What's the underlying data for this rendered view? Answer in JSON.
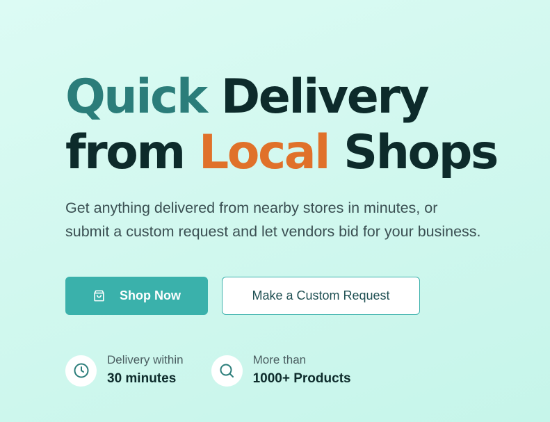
{
  "hero": {
    "headline": {
      "line1_word1": "Quick",
      "line1_word2": "Delivery",
      "line2_word1": "from",
      "line2_word2": "Local",
      "line2_word3": "Shops"
    },
    "subtitle_line1": "Get anything delivered from nearby stores in minutes, or",
    "subtitle_line2": "submit a custom request and let vendors bid for your business."
  },
  "buttons": {
    "shop_now": {
      "label": "Shop Now",
      "icon": "shopping-bag-icon"
    },
    "custom_request": {
      "label": "Make a Custom Request"
    }
  },
  "features": [
    {
      "icon": "clock-icon",
      "label": "Delivery within",
      "value": "30 minutes"
    },
    {
      "icon": "search-icon",
      "label": "More than",
      "value": "1000+ Products"
    }
  ],
  "colors": {
    "accent_teal": "#3ab1ab",
    "quick_word": "#2b7d7a",
    "local_word": "#e0712a",
    "heading_dark": "#0d2b2b"
  }
}
